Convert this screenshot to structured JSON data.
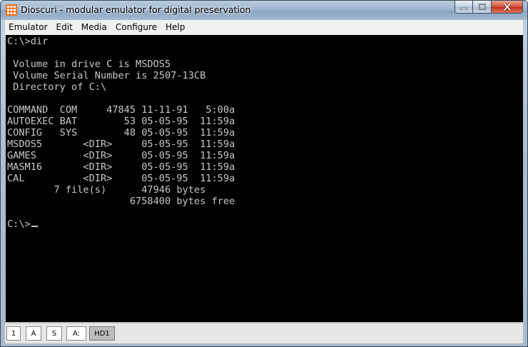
{
  "window": {
    "title": "Dioscuri - modular emulator for digital preservation",
    "app_icon": "dioscuri-grid-icon"
  },
  "menu": {
    "items": [
      {
        "label": "Emulator"
      },
      {
        "label": "Edit"
      },
      {
        "label": "Media"
      },
      {
        "label": "Configure"
      },
      {
        "label": "Help"
      }
    ]
  },
  "console": {
    "lines": [
      "C:\\>dir",
      "",
      " Volume in drive C is MSDOS5",
      " Volume Serial Number is 2507-13CB",
      " Directory of C:\\",
      "",
      "COMMAND  COM     47845 11-11-91   5:00a",
      "AUTOEXEC BAT        53 05-05-95  11:59a",
      "CONFIG   SYS        48 05-05-95  11:59a",
      "MSDOS5       <DIR>     05-05-95  11:59a",
      "GAMES        <DIR>     05-05-95  11:59a",
      "MASM16       <DIR>     05-05-95  11:59a",
      "CAL          <DIR>     05-05-95  11:59a",
      "        7 file(s)      47946 bytes",
      "                     6758400 bytes free",
      "",
      "C:\\>"
    ],
    "text_color": "#c8c8c8",
    "background": "#000000"
  },
  "status": {
    "indicators": [
      {
        "label": "1",
        "active": false
      },
      {
        "label": "A",
        "active": false
      },
      {
        "label": "S",
        "active": false
      },
      {
        "label": "A:",
        "active": false
      },
      {
        "label": "HD1",
        "active": true
      }
    ]
  }
}
